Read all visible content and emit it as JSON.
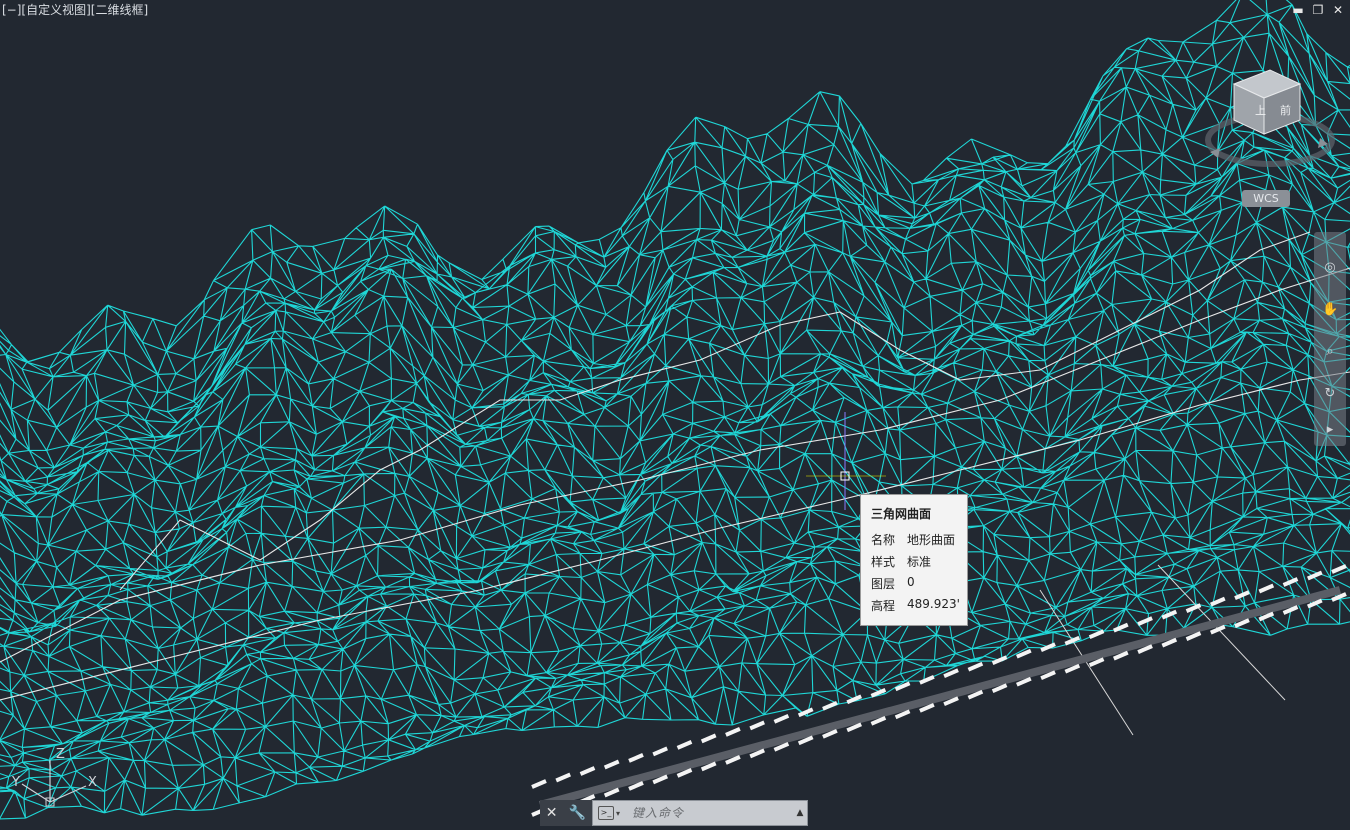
{
  "viewport": {
    "controls_label": "[−][自定义视图][二维线框]",
    "background": "#222831",
    "mesh_color": "#1fd6d6"
  },
  "window_controls": {
    "minimize_glyph": "▬",
    "restore_glyph": "❐",
    "close_glyph": "✕"
  },
  "viewcube": {
    "wcs_label": "WCS"
  },
  "tooltip": {
    "title": "三角网曲面",
    "rows": [
      {
        "key": "名称",
        "value": "地形曲面"
      },
      {
        "key": "样式",
        "value": "标准"
      },
      {
        "key": "图层",
        "value": "0"
      },
      {
        "key": "高程",
        "value": "489.923'"
      }
    ]
  },
  "ucs": {
    "x_label": "X",
    "y_label": "Y",
    "z_label": "Z"
  },
  "command_line": {
    "close_glyph": "✕",
    "customize_glyph": "🔧",
    "placeholder": "键入命令",
    "history_glyph": "▲"
  }
}
